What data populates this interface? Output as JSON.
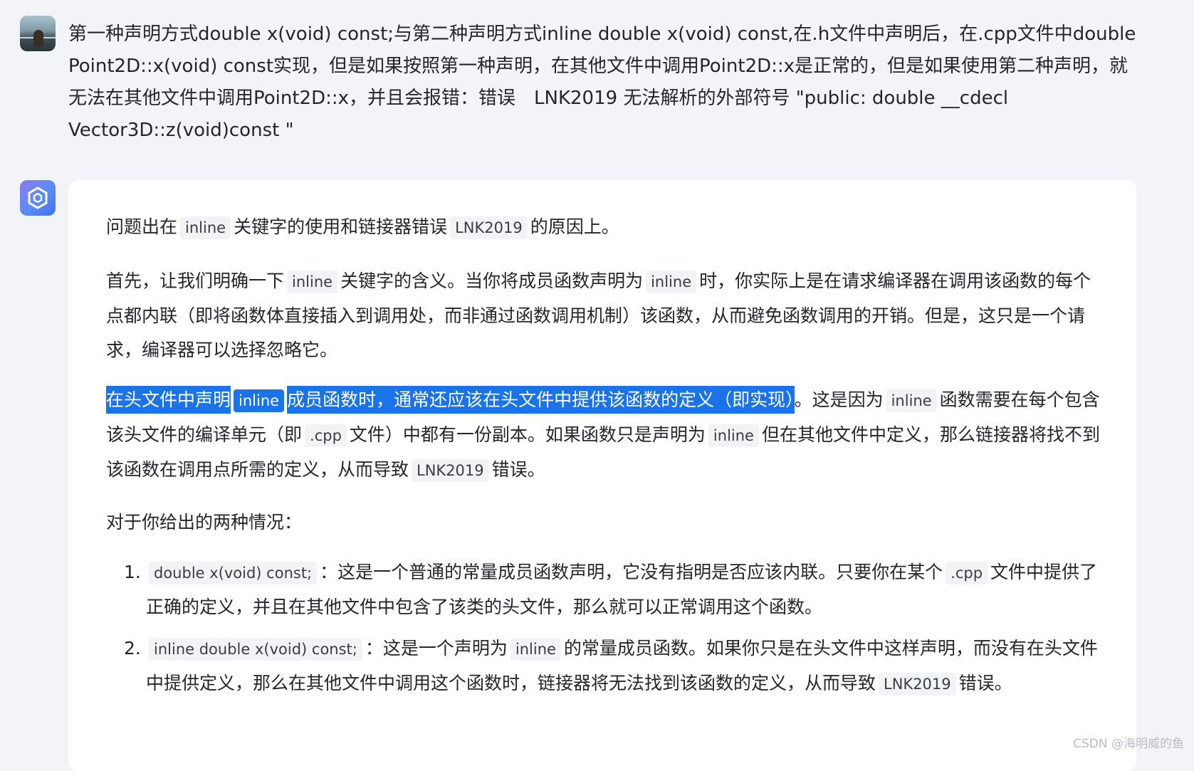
{
  "user_message": {
    "t1": "第一种声明方式double x(void) const;与第二种声明方式inline double x(void) const,在.h文件中声明后，在.cpp文件中double Point2D::x(void) const实现，但是如果按照第一种声明，在其他文件中调用Point2D::x是正常的，但是如果使用第二种声明，就无法在其他文件中调用Point2D::x，并且会报错：错误　LNK2019 无法解析的外部符号 \"public: double __cdecl Vector3D::z(void)const \""
  },
  "answer": {
    "p1": {
      "a": "问题出在",
      "c1": "inline",
      "b": "关键字的使用和链接器错误",
      "c2": "LNK2019",
      "d": "的原因上。"
    },
    "p2": {
      "a": "首先，让我们明确一下",
      "c1": "inline",
      "b": "关键字的含义。当你将成员函数声明为",
      "c2": "inline",
      "d": "时，你实际上是在请求编译器在调用该函数的每个点都内联（即将函数体直接插入到调用处，而非通过函数调用机制）该函数，从而避免函数调用的开销。但是，这只是一个请求，编译器可以选择忽略它。"
    },
    "p3": {
      "hl_a": "在头文件中声明",
      "hl_code": "inline",
      "hl_b": "成员函数时，通常还应该在头文件中提供该函数的定义（即实现）",
      "a": "。这是因为",
      "c1": "inline",
      "b": "函数需要在每个包含该头文件的编译单元（即",
      "c2": ".cpp",
      "c": "文件）中都有一份副本。如果函数只是声明为",
      "c3": "inline",
      "d": "但在其他文件中定义，那么链接器将找不到该函数在调用点所需的定义，从而导致",
      "c4": "LNK2019",
      "e": "错误。"
    },
    "p4": "对于你给出的两种情况：",
    "item1": {
      "num": "1.",
      "c1": "double x(void) const;",
      "a": "：这是一个普通的常量成员函数声明，它没有指明是否应该内联。只要你在某个",
      "c2": ".cpp",
      "b": "文件中提供了正确的定义，并且在其他文件中包含了该类的头文件，那么就可以正常调用这个函数。"
    },
    "item2": {
      "num": "2.",
      "c1": "inline double x(void) const;",
      "a": "：这是一个声明为",
      "c2": "inline",
      "b": "的常量成员函数。如果你只是在头文件中这样声明，而没有在头文件中提供定义，那么在其他文件中调用这个函数时，链接器将无法找到该函数的定义，从而导致",
      "c3": "LNK2019",
      "c": "错误。"
    }
  },
  "watermark": "CSDN @海明威的鱼",
  "colors": {
    "highlight": "#1a73e8",
    "background": "#f3f4f7",
    "card": "#ffffff"
  },
  "icons": {
    "user_avatar": "user-avatar-photo",
    "bot_avatar": "assistant-logo-icon"
  }
}
